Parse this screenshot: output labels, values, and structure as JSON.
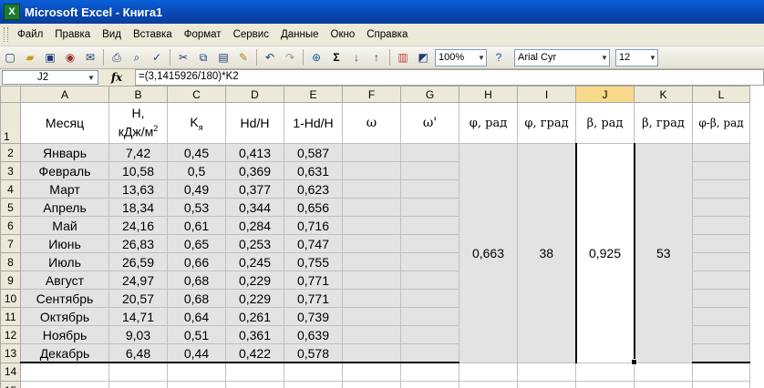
{
  "window": {
    "title": "Microsoft Excel - Книга1",
    "app_icon": "excel-icon"
  },
  "menu": [
    "Файл",
    "Правка",
    "Вид",
    "Вставка",
    "Формат",
    "Сервис",
    "Данные",
    "Окно",
    "Справка"
  ],
  "toolbar": {
    "zoom": "100%",
    "font_name": "Arial Cyr",
    "font_size": "12",
    "icons": [
      "new-icon",
      "open-icon",
      "save-icon",
      "permission-icon",
      "email-icon",
      "print-icon",
      "print-preview-icon",
      "spelling-icon",
      "cut-icon",
      "copy-icon",
      "paste-icon",
      "format-painter-icon",
      "undo-icon",
      "redo-icon",
      "hyperlink-icon",
      "autosum-icon",
      "sort-ascending-icon",
      "sort-descending-icon",
      "chart-wizard-icon",
      "drawing-icon",
      "help-icon"
    ]
  },
  "formula_bar": {
    "cell": "J2",
    "fx": "fx",
    "formula": "=(3,1415926/180)*K2"
  },
  "columns": [
    "A",
    "B",
    "C",
    "D",
    "E",
    "F",
    "G",
    "H",
    "I",
    "J",
    "K",
    "L"
  ],
  "selected_column": "J",
  "header_row": {
    "row": "1",
    "A": "Месяц",
    "B_line1": "H,",
    "B_line2": "кДж/м",
    "B_sup": "2",
    "C_main": "K",
    "C_sub": "я",
    "D": "Hd/H",
    "E": "1-Hd/H",
    "F": "ω",
    "G": "ω'",
    "H": "φ, рад",
    "I": "φ, град",
    "J": "β, рад",
    "K": "β, град",
    "L": "φ-β, рад"
  },
  "rows": [
    {
      "n": "2",
      "month": "Январь",
      "h": "7,42",
      "k": "0,45",
      "hd": "0,413",
      "one": "0,587"
    },
    {
      "n": "3",
      "month": "Февраль",
      "h": "10,58",
      "k": "0,5",
      "hd": "0,369",
      "one": "0,631"
    },
    {
      "n": "4",
      "month": "Март",
      "h": "13,63",
      "k": "0,49",
      "hd": "0,377",
      "one": "0,623"
    },
    {
      "n": "5",
      "month": "Апрель",
      "h": "18,34",
      "k": "0,53",
      "hd": "0,344",
      "one": "0,656"
    },
    {
      "n": "6",
      "month": "Май",
      "h": "24,16",
      "k": "0,61",
      "hd": "0,284",
      "one": "0,716"
    },
    {
      "n": "7",
      "month": "Июнь",
      "h": "26,83",
      "k": "0,65",
      "hd": "0,253",
      "one": "0,747"
    },
    {
      "n": "8",
      "month": "Июль",
      "h": "26,59",
      "k": "0,66",
      "hd": "0,245",
      "one": "0,755"
    },
    {
      "n": "9",
      "month": "Август",
      "h": "24,97",
      "k": "0,68",
      "hd": "0,229",
      "one": "0,771"
    },
    {
      "n": "10",
      "month": "Сентябрь",
      "h": "20,57",
      "k": "0,68",
      "hd": "0,229",
      "one": "0,771"
    },
    {
      "n": "11",
      "month": "Октябрь",
      "h": "14,71",
      "k": "0,64",
      "hd": "0,261",
      "one": "0,739"
    },
    {
      "n": "12",
      "month": "Ноябрь",
      "h": "9,03",
      "k": "0,51",
      "hd": "0,361",
      "one": "0,639"
    },
    {
      "n": "13",
      "month": "Декабрь",
      "h": "6,48",
      "k": "0,44",
      "hd": "0,422",
      "one": "0,578"
    }
  ],
  "merged": {
    "H": "0,663",
    "I": "38",
    "J": "0,925",
    "K": "53"
  },
  "empty_rows": [
    "14",
    "15"
  ]
}
